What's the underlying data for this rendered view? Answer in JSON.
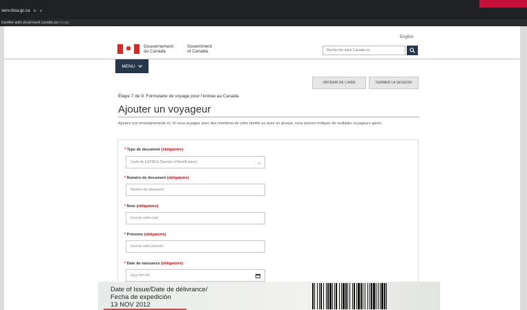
{
  "browser": {
    "tab_title": "serv.cbsa.gc.ca",
    "tab_close": "×",
    "new_tab": "+",
    "url_host": "traveller-auth.cloud-travel.canada.ca",
    "url_path": "/voyage"
  },
  "header": {
    "language_link": "English",
    "gov_fr_line1": "Gouvernement",
    "gov_fr_line2": "du Canada",
    "gov_en_line1": "Government",
    "gov_en_line2": "of Canada",
    "search_placeholder": "Recherche dans Canada.ca",
    "menu_label": "MENU"
  },
  "actions": {
    "help_button": "OBTENIR DE L'AIDE",
    "logout_button": "FERMER LA SESSION"
  },
  "main": {
    "step_text": "Étape 7 de 9: Formulaire de voyage pour l'entrée au Canada",
    "title": "Ajouter un voyageur",
    "intro": "Ajoutez vos renseignements ici. Si vous voyagez avec des membres de votre famille ou avec un groupe, vous pouvez indiquer de multiples voyageurs après."
  },
  "form": {
    "fields": [
      {
        "label": "Type de document",
        "required_text": "(obligatoire)",
        "value": "Carte de EXPRES (Numéro d'identification)"
      },
      {
        "label": "Numéro de document",
        "required_text": "(obligatoire)",
        "placeholder": "Numéro de document"
      },
      {
        "label": "Nom",
        "required_text": "(obligatoire)",
        "placeholder": "Inscrire votre nom"
      },
      {
        "label": "Prénoms",
        "required_text": "(obligatoire)",
        "placeholder": "Inscrire votre prénom"
      },
      {
        "label": "Date de naissance",
        "required_text": "(obligatoire)",
        "placeholder": "yyyy-mm-dd"
      }
    ]
  },
  "document_photo": {
    "line1": "Date of Issue/Date de délivrance/",
    "line2": "Fecha de expedición",
    "line3": "13 NOV 2012"
  }
}
